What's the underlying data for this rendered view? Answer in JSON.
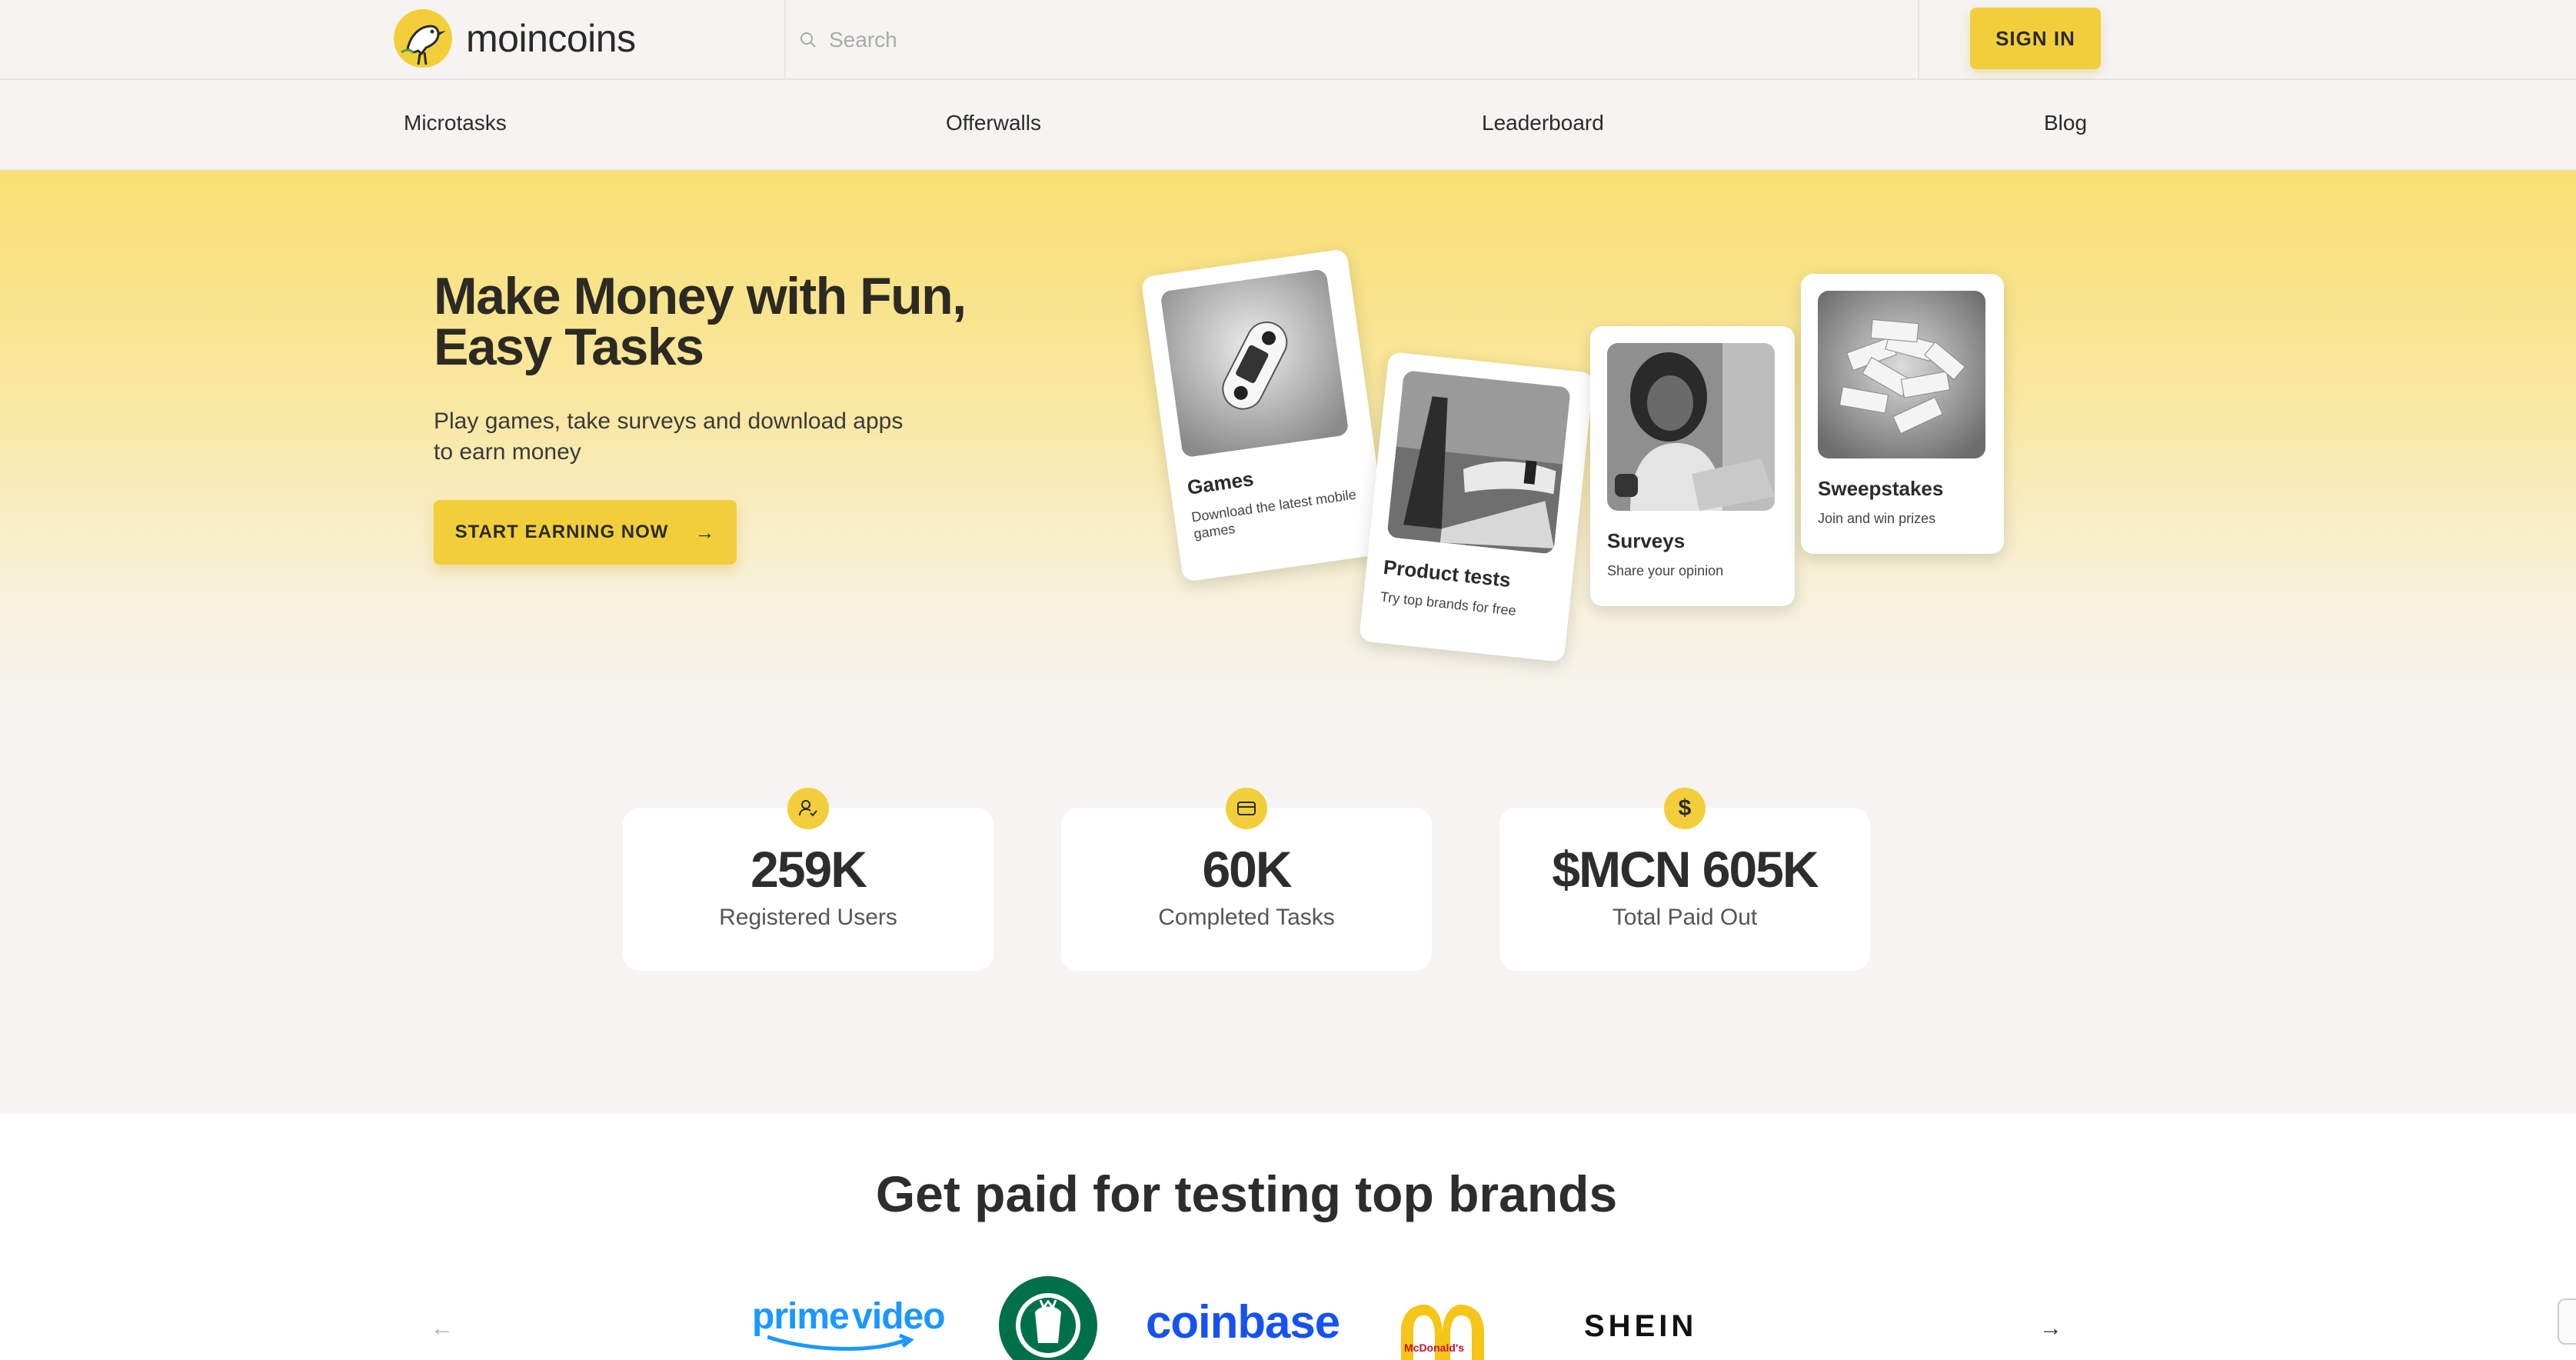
{
  "header": {
    "brand": "moincoins",
    "search_placeholder": "Search",
    "signin_label": "SIGN IN"
  },
  "nav": {
    "items": [
      {
        "label": "Microtasks"
      },
      {
        "label": "Offerwalls"
      },
      {
        "label": "Leaderboard"
      },
      {
        "label": "Blog"
      }
    ]
  },
  "hero": {
    "title": "Make Money with Fun, Easy Tasks",
    "subtitle": "Play games, take surveys and download apps to earn money",
    "cta_label": "START EARNING NOW",
    "cta_icon": "arrow-right-icon",
    "cards": [
      {
        "title": "Games",
        "desc": "Download the latest mobile games",
        "image": "game-controller"
      },
      {
        "title": "Product tests",
        "desc": "Try top brands for free",
        "image": "laptop-hands"
      },
      {
        "title": "Surveys",
        "desc": "Share your opinion",
        "image": "woman-laptop"
      },
      {
        "title": "Sweepstakes",
        "desc": "Join and win prizes",
        "image": "ticket-pile"
      }
    ]
  },
  "stats": [
    {
      "value": "259K",
      "label": "Registered Users",
      "icon": "user-check-icon"
    },
    {
      "value": "60K",
      "label": "Completed Tasks",
      "icon": "card-icon"
    },
    {
      "value": "$MCN 605K",
      "label": "Total Paid Out",
      "icon": "dollar-icon"
    }
  ],
  "brands": {
    "title": "Get paid for testing top brands",
    "logos": [
      {
        "name": "prime video",
        "text_a": "prime",
        "text_b": "video"
      },
      {
        "name": "Starbucks"
      },
      {
        "name": "coinbase",
        "text": "coinbase"
      },
      {
        "name": "McDonald's",
        "text": "McDonald's"
      },
      {
        "name": "SHEIN",
        "text": "SHEIN"
      }
    ]
  },
  "colors": {
    "accent": "#f2cf3a",
    "hero_top": "#f8df72",
    "background": "#f5f4f2",
    "coinbase_blue": "#1652f0",
    "prime_blue": "#1a98ff",
    "starbucks_green": "#00704a"
  }
}
